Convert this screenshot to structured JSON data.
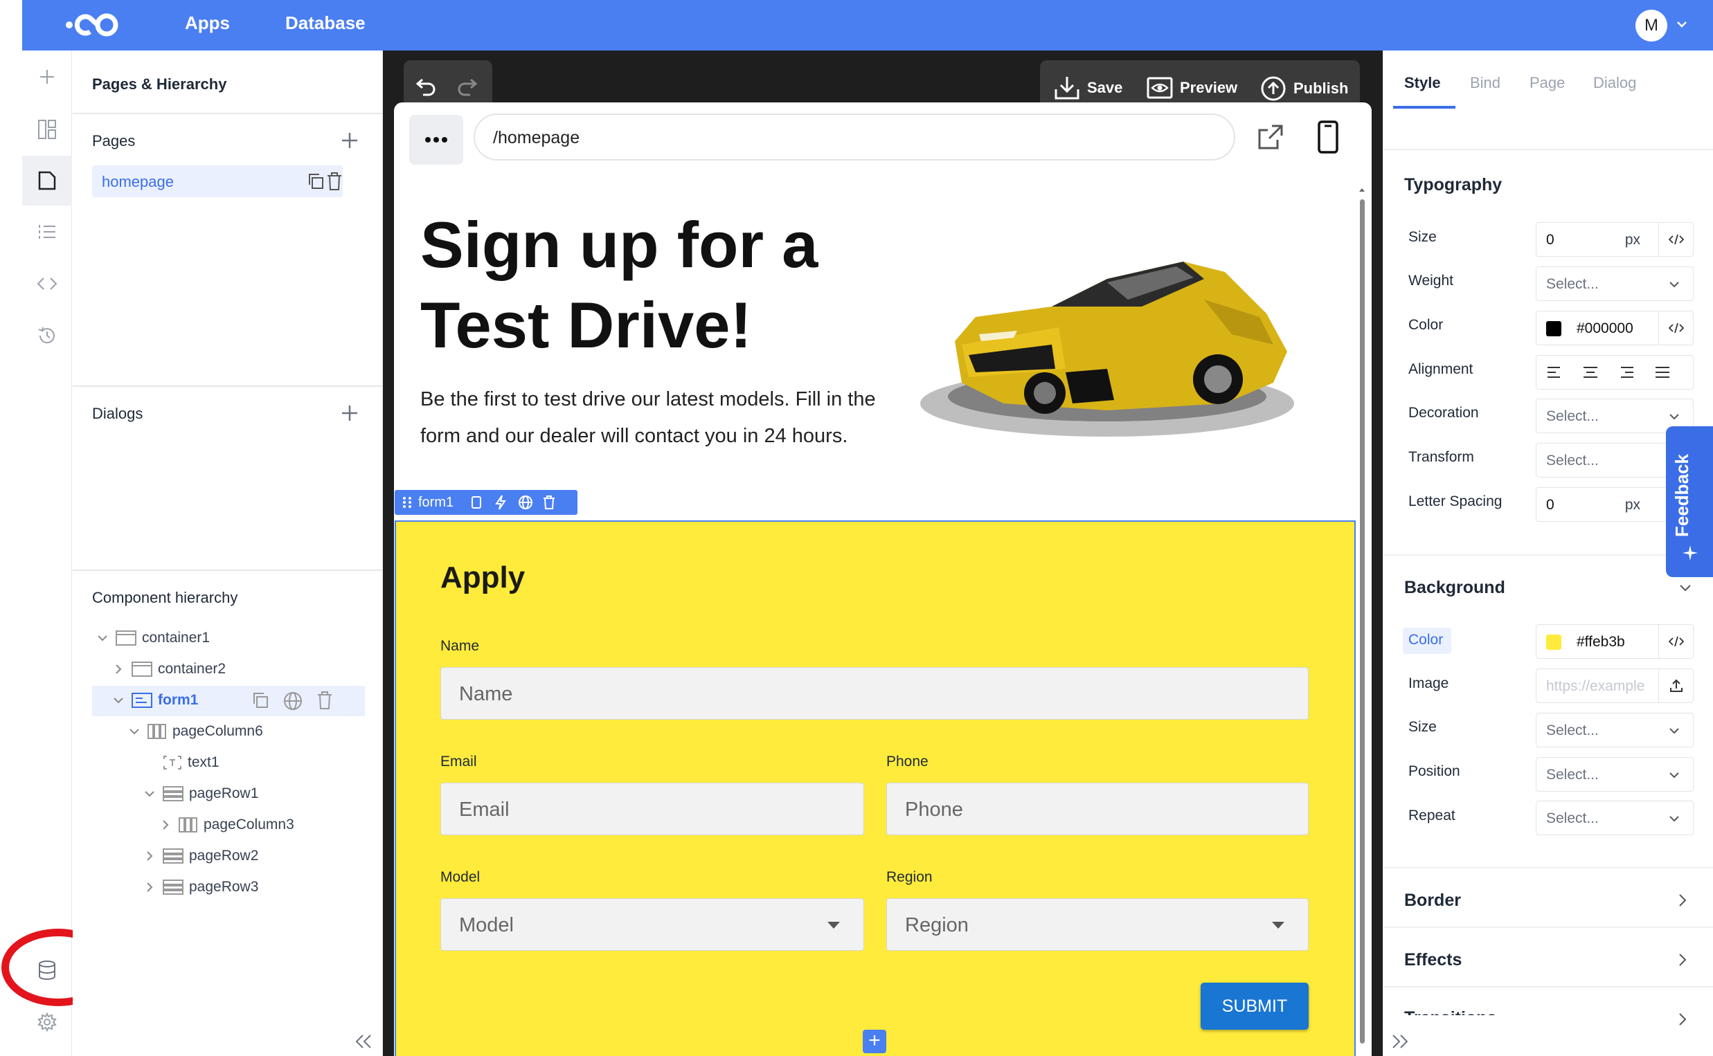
{
  "topbar": {
    "nav": [
      "Apps",
      "Database"
    ],
    "avatar_initial": "M"
  },
  "left_panel": {
    "title": "Pages & Hierarchy",
    "pages_heading": "Pages",
    "pages": [
      "homepage"
    ],
    "dialogs_heading": "Dialogs",
    "hierarchy_heading": "Component hierarchy",
    "tree": [
      "container1",
      "container2",
      "form1",
      "pageColumn6",
      "text1",
      "pageRow1",
      "pageColumn3",
      "pageRow2",
      "pageRow3"
    ]
  },
  "toolbar": {
    "save": "Save",
    "preview": "Preview",
    "publish": "Publish"
  },
  "canvas": {
    "url": "/homepage",
    "hero_title": "Sign up for a Test Drive!",
    "hero_text": "Be the first to test drive our latest models. Fill in the form and our dealer will contact you in 24 hours.",
    "selected_component": "form1",
    "form": {
      "heading": "Apply",
      "name_label": "Name",
      "name_placeholder": "Name",
      "email_label": "Email",
      "email_placeholder": "Email",
      "phone_label": "Phone",
      "phone_placeholder": "Phone",
      "model_label": "Model",
      "model_placeholder": "Model",
      "region_label": "Region",
      "region_placeholder": "Region",
      "submit": "SUBMIT",
      "background_color": "#ffeb3b"
    }
  },
  "right_panel": {
    "tabs": [
      "Style",
      "Bind",
      "Page",
      "Dialog"
    ],
    "typography": {
      "heading": "Typography",
      "size_label": "Size",
      "size_value": "0",
      "size_unit": "px",
      "weight_label": "Weight",
      "weight_value": "Select...",
      "color_label": "Color",
      "color_value": "#000000",
      "alignment_label": "Alignment",
      "decoration_label": "Decoration",
      "decoration_value": "Select...",
      "transform_label": "Transform",
      "transform_value": "Select...",
      "letter_spacing_label": "Letter Spacing",
      "letter_spacing_value": "0",
      "letter_spacing_unit": "px"
    },
    "background": {
      "heading": "Background",
      "color_label": "Color",
      "color_value": "#ffeb3b",
      "image_label": "Image",
      "image_placeholder": "https://example",
      "size_label": "Size",
      "size_value": "Select...",
      "position_label": "Position",
      "position_value": "Select...",
      "repeat_label": "Repeat",
      "repeat_value": "Select..."
    },
    "sections": [
      "Border",
      "Effects",
      "Transitions"
    ],
    "feedback": "Feedback"
  }
}
